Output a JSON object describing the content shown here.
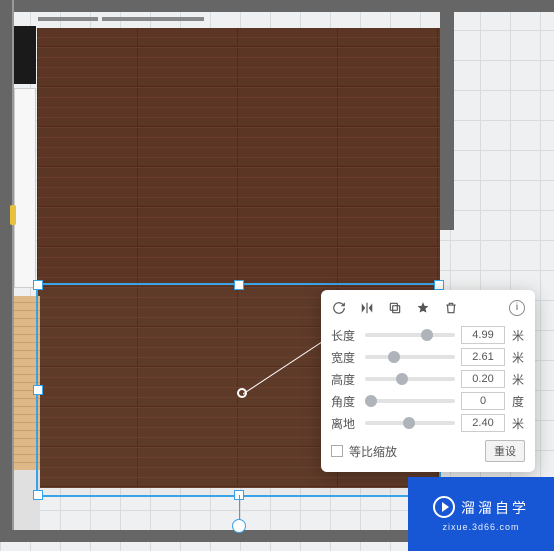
{
  "panel": {
    "toolbar_icons": [
      "rotate",
      "mirror",
      "copy",
      "favorite",
      "delete",
      "info"
    ],
    "rows": [
      {
        "label": "长度",
        "value": "4.99",
        "unit": "米",
        "pos": 62
      },
      {
        "label": "宽度",
        "value": "2.61",
        "unit": "米",
        "pos": 25
      },
      {
        "label": "高度",
        "value": "0.20",
        "unit": "米",
        "pos": 34
      },
      {
        "label": "角度",
        "value": "0",
        "unit": "度",
        "pos": 0
      },
      {
        "label": "离地",
        "value": "2.40",
        "unit": "米",
        "pos": 42
      }
    ],
    "proportional_label": "等比缩放",
    "reset_label": "重设"
  },
  "watermark": {
    "title": "溜溜自学",
    "sub": "zixue.3d66.com"
  }
}
